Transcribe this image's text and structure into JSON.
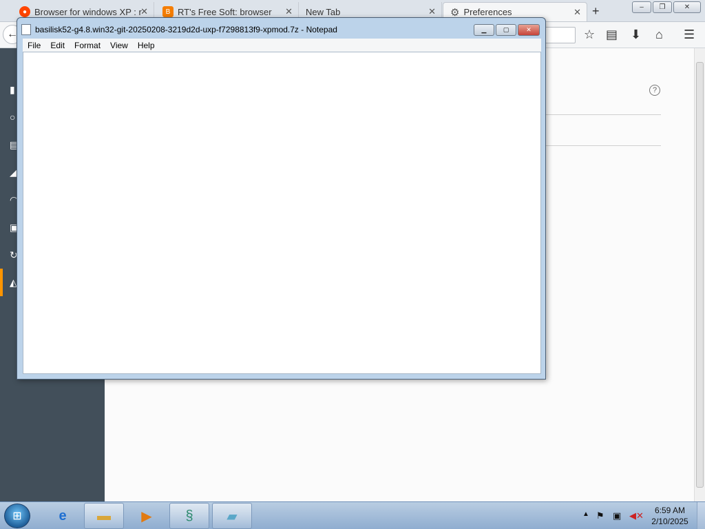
{
  "browser": {
    "tabs": [
      {
        "label": "Browser for windows XP : r",
        "icon": "reddit-icon",
        "color": "#ff4500"
      },
      {
        "label": "RT's Free Soft: browser",
        "icon": "blogger-icon",
        "color": "#f57d00"
      },
      {
        "label": "New Tab",
        "icon": "none"
      },
      {
        "label": "Preferences",
        "icon": "gear-icon"
      }
    ],
    "new_tab_glyph": "+",
    "window_controls": {
      "minimize": "–",
      "restore": "❐",
      "close": "✕"
    },
    "nav_icons": [
      "back-icon",
      "star-icon",
      "reading-list-icon",
      "download-icon",
      "home-icon",
      "menu-icon"
    ]
  },
  "preferences": {
    "help_glyph": "?",
    "sidebar_accent": "#ff9500",
    "sidebar_bg": "#424f5a"
  },
  "notepad": {
    "title": "basilisk52-g4.8.win32-git-20250208-3219d2d-uxp-f7298813f9-xpmod.7z - Notepad",
    "menu": [
      "File",
      "Edit",
      "Format",
      "View",
      "Help"
    ],
    "content": ""
  },
  "taskbar": {
    "start_glyph": "⊞",
    "pinned": [
      "internet-explorer-icon",
      "file-explorer-icon",
      "media-player-icon",
      "basilisk-icon",
      "notepad-icon"
    ],
    "clock": {
      "time": "6:59 AM",
      "date": "2/10/2025"
    }
  }
}
